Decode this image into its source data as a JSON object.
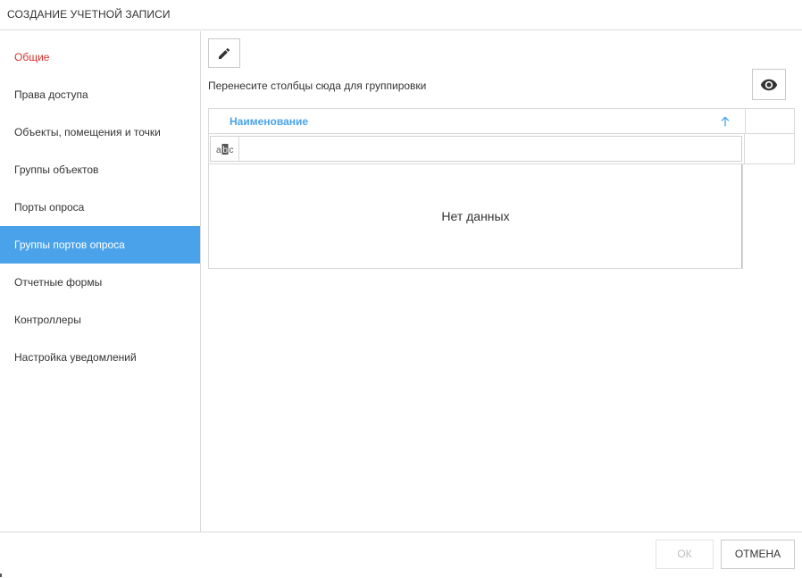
{
  "dialog": {
    "title": "СОЗДАНИЕ УЧЕТНОЙ ЗАПИСИ"
  },
  "sidebar": {
    "active_color": "#4aa3ea",
    "items": [
      {
        "label": "Общие",
        "state": "error"
      },
      {
        "label": "Права доступа",
        "state": "normal"
      },
      {
        "label": "Объекты, помещения и точки",
        "state": "normal"
      },
      {
        "label": "Группы объектов",
        "state": "normal"
      },
      {
        "label": "Порты опроса",
        "state": "normal"
      },
      {
        "label": "Группы портов опроса",
        "state": "active"
      },
      {
        "label": "Отчетные формы",
        "state": "normal"
      },
      {
        "label": "Контроллеры",
        "state": "normal"
      },
      {
        "label": "Настройка уведомлений",
        "state": "normal"
      }
    ]
  },
  "toolbar": {
    "edit_icon": "pencil-icon",
    "column_chooser_icon": "eye-icon"
  },
  "grid": {
    "group_panel_text": "Перенесите столбцы сюда для группировки",
    "columns": [
      {
        "label": "Наименование",
        "sort": "ascending"
      }
    ],
    "filter": {
      "type_icon": "abc-icon",
      "value": ""
    },
    "no_data_text": "Нет данных",
    "header_color": "#4aa3ea"
  },
  "footer": {
    "ok_label": "ОК",
    "cancel_label": "ОТМЕНА",
    "ok_disabled": true
  }
}
